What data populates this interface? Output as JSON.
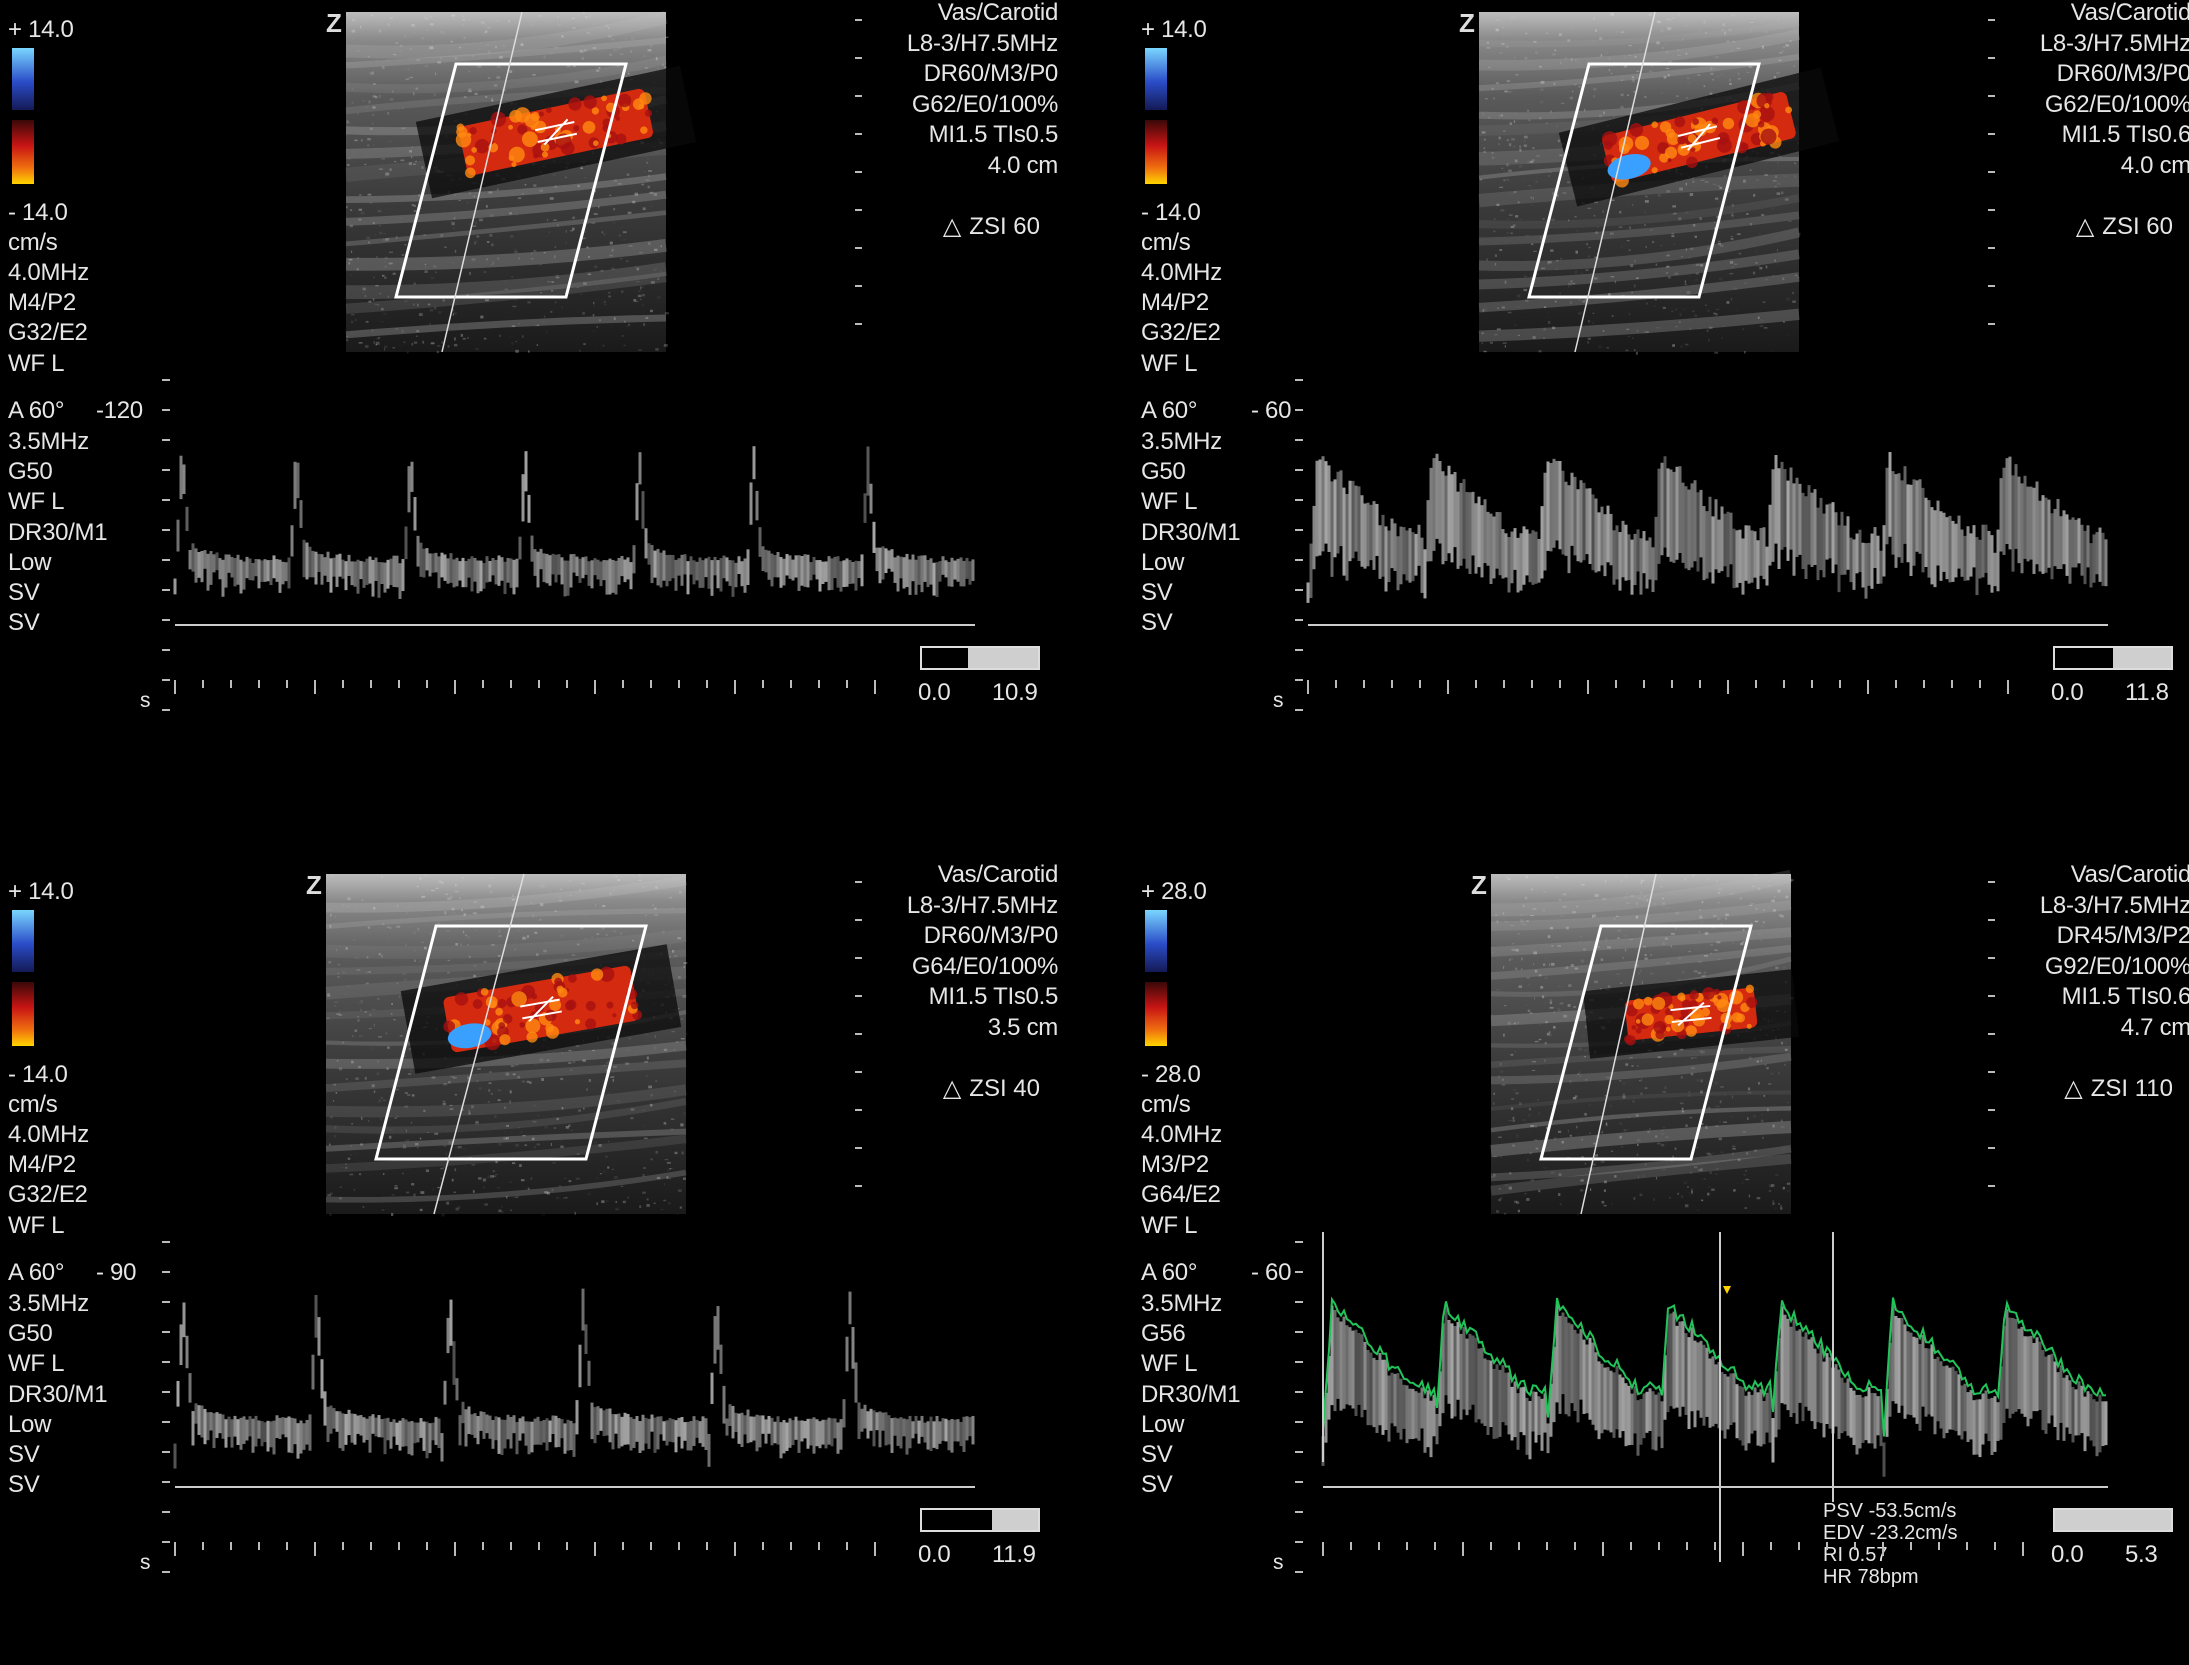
{
  "panels": [
    {
      "id": "top-left",
      "color_scale": {
        "top": "+ 14.0",
        "bottom": "- 14.0",
        "unit": "cm/s"
      },
      "color_params": [
        "4.0MHz",
        "M4/P2",
        "G32/E2",
        "WF L"
      ],
      "pw_params": {
        "angle": "A 60°",
        "scale": "-120",
        "list": [
          "3.5MHz",
          "G50",
          "WF L",
          "DR30/M1",
          "Low",
          "SV",
          "SV"
        ]
      },
      "probe_info": [
        "Vas/Carotid",
        "L8-3/H7.5MHz",
        "DR60/M3/P0",
        "G62/E0/100%",
        "MI1.5  TIs0.5",
        "4.0 cm"
      ],
      "zsi": "ZSI 60",
      "time_unit": "s",
      "time_scale": {
        "start": "0.0",
        "end": "10.9"
      }
    },
    {
      "id": "top-right",
      "color_scale": {
        "top": "+ 14.0",
        "bottom": "- 14.0",
        "unit": "cm/s"
      },
      "color_params": [
        "4.0MHz",
        "M4/P2",
        "G32/E2",
        "WF L"
      ],
      "pw_params": {
        "angle": "A 60°",
        "scale": "- 60",
        "list": [
          "3.5MHz",
          "G50",
          "WF L",
          "DR30/M1",
          "Low",
          "SV",
          "SV"
        ]
      },
      "probe_info": [
        "Vas/Carotid",
        "L8-3/H7.5MHz",
        "DR60/M3/P0",
        "G62/E0/100%",
        "MI1.5  TIs0.6",
        "4.0 cm"
      ],
      "zsi": "ZSI 60",
      "time_unit": "s",
      "time_scale": {
        "start": "0.0",
        "end": "11.8"
      }
    },
    {
      "id": "bottom-left",
      "color_scale": {
        "top": "+ 14.0",
        "bottom": "- 14.0",
        "unit": "cm/s"
      },
      "color_params": [
        "4.0MHz",
        "M4/P2",
        "G32/E2",
        "WF L"
      ],
      "pw_params": {
        "angle": "A 60°",
        "scale": "- 90",
        "list": [
          "3.5MHz",
          "G50",
          "WF L",
          "DR30/M1",
          "Low",
          "SV",
          "SV"
        ]
      },
      "probe_info": [
        "Vas/Carotid",
        "L8-3/H7.5MHz",
        "DR60/M3/P0",
        "G64/E0/100%",
        "MI1.5  TIs0.5",
        "3.5 cm"
      ],
      "zsi": "ZSI 40",
      "time_unit": "s",
      "time_scale": {
        "start": "0.0",
        "end": "11.9"
      }
    },
    {
      "id": "bottom-right",
      "color_scale": {
        "top": "+ 28.0",
        "bottom": "- 28.0",
        "unit": "cm/s"
      },
      "color_params": [
        "4.0MHz",
        "M3/P2",
        "G64/E2",
        "WF L"
      ],
      "pw_params": {
        "angle": "A 60°",
        "scale": "- 60",
        "list": [
          "3.5MHz",
          "G56",
          "WF L",
          "DR30/M1",
          "Low",
          "SV",
          "SV"
        ]
      },
      "probe_info": [
        "Vas/Carotid",
        "L8-3/H7.5MHz",
        "DR45/M3/P2",
        "G92/E0/100%",
        "MI1.5  TIs0.6",
        "4.7 cm"
      ],
      "zsi": "ZSI 110",
      "time_unit": "s",
      "time_scale": {
        "start": "0.0",
        "end": "5.3"
      },
      "measurements": [
        "PSV -53.5cm/s",
        "EDV -23.2cm/s",
        "RI 0.57",
        "HR 78bpm"
      ]
    }
  ],
  "colors": {
    "trace": "#22c45a",
    "text": "#e6e6e6",
    "flow_red": "#d42a10",
    "flow_orange": "#ff8a10",
    "flow_blue": "#3aa0ff",
    "marker": "#ffd400"
  }
}
